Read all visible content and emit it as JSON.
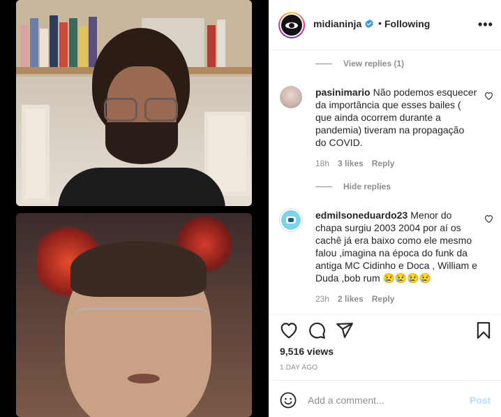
{
  "header": {
    "username": "midianinja",
    "separator": "•",
    "follow_status": "Following",
    "more_label": "•••",
    "accent_ring_colors": [
      "#f9ce34",
      "#ee2a7b",
      "#6228d7"
    ],
    "verified_color": "#3897f0"
  },
  "replies_toggle_1": {
    "label": "View replies (1)"
  },
  "comments": [
    {
      "username": "pasinimario",
      "text": "Não podemos esquecer da importância que esses bailes ( que ainda ocorrem durante a pandemia) tiveram na propagação do COVID.",
      "time": "18h",
      "likes": "3 likes",
      "reply": "Reply"
    },
    {
      "username": "edmilsoneduardo23",
      "text": "Menor do chapa surgiu 2003 2004 por aí os cachê já era baixo como ele mesmo falou ,imagina na época do funk da antiga MC Cidinho e Doca , William e Duda ,bob rum 😢😢😢😢",
      "time": "23h",
      "likes": "2 likes",
      "reply": "Reply"
    }
  ],
  "replies_toggle_2": {
    "label": "Hide replies"
  },
  "actions": {
    "like_icon": "heart-icon",
    "comment_icon": "comment-icon",
    "share_icon": "share-icon",
    "save_icon": "bookmark-icon"
  },
  "stats": {
    "views": "9,516 views",
    "posted_ago": "1 DAY AGO"
  },
  "add_comment": {
    "placeholder": "Add a comment...",
    "post_label": "Post"
  }
}
